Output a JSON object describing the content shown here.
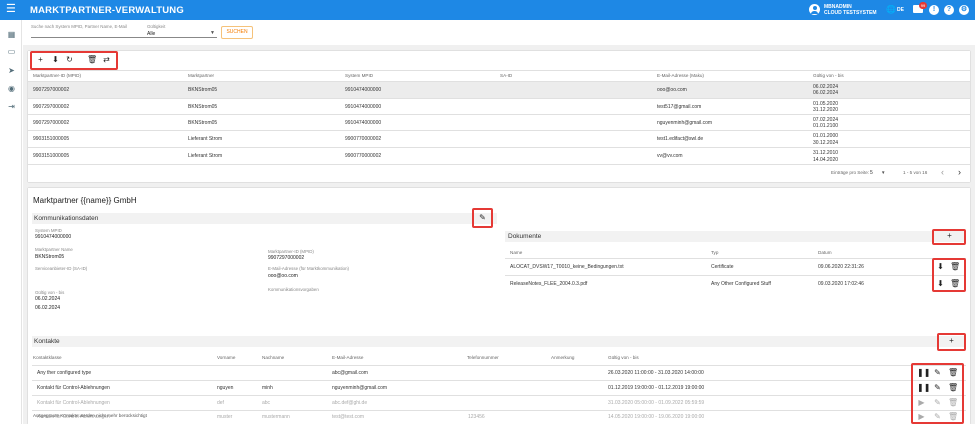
{
  "app": {
    "title": "MARKTPARTNER-VERWALTUNG",
    "user_name": "MBNADMIN",
    "user_system": "CLOUD TESTSYSTEM",
    "lang": "DE",
    "notif_count": "99"
  },
  "search": {
    "placeholder": "Suche nach System MPID, Partner Name, E-Mail",
    "gueltig_label": "Gültigkeit",
    "gueltig_value": "Alle",
    "button": "SUCHEN"
  },
  "table": {
    "headers": [
      "Marktpartner-ID (MPID)",
      "Marktpartner",
      "System MPID",
      "SA-ID",
      "E-Mail-Adresse (Maku)",
      "Gültig von - bis"
    ],
    "rows": [
      {
        "mpid": "9907297000002",
        "partner": "BKNStrom05",
        "system": "9910474000000",
        "said": "",
        "email": "ooo@oo.com",
        "valid": [
          "06.02.2024",
          "06.02.2024"
        ]
      },
      {
        "mpid": "9907297000002",
        "partner": "BKNStrom05",
        "system": "9910474000000",
        "said": "",
        "email": "test517@gmail.com",
        "valid": [
          "01.05.2020",
          "31.12.2020"
        ]
      },
      {
        "mpid": "9907297000002",
        "partner": "BKNStrom05",
        "system": "9910474000000",
        "said": "",
        "email": "nguyenminh@gmail.com",
        "valid": [
          "07.02.2024",
          "01.01.2100"
        ]
      },
      {
        "mpid": "9903151000005",
        "partner": "Lieferant Strom",
        "system": "9900770000002",
        "said": "",
        "email": "test1.edifact@swl.de",
        "valid": [
          "01.01.2000",
          "30.12.2024"
        ]
      },
      {
        "mpid": "9903151000005",
        "partner": "Lieferant Strom",
        "system": "9900770000002",
        "said": "",
        "email": "vv@vv.com",
        "valid": [
          "31.12.2010",
          "14.04.2020"
        ]
      }
    ],
    "per_page_label": "Einträge pro Seite:",
    "per_page": "5",
    "range": "1 - 5 von 16"
  },
  "detail": {
    "title": "Marktpartner {{name}} GmbH",
    "komm": {
      "title": "Kommunikationsdaten",
      "system_mpid_label": "System MPID",
      "system_mpid": "9910474000000",
      "name_label": "Marktpartner Name",
      "name": "BKNStrom05",
      "mpid_label": "Marktpartner-ID (MPID)",
      "mpid": "9907297000002",
      "said_label": "Serviceanbieter-ID (SA-ID)",
      "email_label": "E-Mail-Adresse (für Marktkommunikation)",
      "email": "ooo@oo.com",
      "vorgaben_label": "Kommunikationsvorgaben",
      "valid_label": "Gültig von - bis",
      "valid_from": "06.02.2024",
      "valid_to": "06.02.2024"
    },
    "docs": {
      "title": "Dokumente",
      "headers": [
        "Name",
        "Typ",
        "Datum"
      ],
      "rows": [
        {
          "name": "ALOCAT_DVSW17_T0010_keine_Bedingungen.txt",
          "typ": "Certificate",
          "datum": "09.06.2020 22:31:26"
        },
        {
          "name": "ReleaseNotes_FLEE_2004.0.3.pdf",
          "typ": "Any Other Configured Stuff",
          "datum": "09.03.2020 17:02:46"
        }
      ]
    },
    "kontakte": {
      "title": "Kontakte",
      "headers": [
        "Kontaktklasse",
        "Vorname",
        "Nachname",
        "E-Mail-Adresse",
        "Telefonnummer",
        "Anmerkung",
        "Gültig von - bis"
      ],
      "rows": [
        {
          "klasse": "Any ther configured type",
          "vorname": "",
          "nachname": "",
          "email": "abc@gmail.com",
          "tel": "",
          "anm": "",
          "valid": "26.03.2020 11:00:00 - 31.03.2020 14:00:00"
        },
        {
          "klasse": "Kontakt für Control-Ablehnungen",
          "vorname": "nguyen",
          "nachname": "minh",
          "email": "nguyenminh@gmail.com",
          "tel": "",
          "anm": "",
          "valid": "01.12.2019 19:00:00 - 01.12.2019 19:00:00"
        },
        {
          "klasse": "Kontakt für Control-Ablehnungen",
          "vorname": "def",
          "nachname": "abc",
          "email": "abc.def@ghi.de",
          "tel": "",
          "anm": "",
          "valid": "31.03.2020 05:00:00 - 01.09.2022 05:59:59"
        },
        {
          "klasse": "Kontakt für Control-Ablehnungen",
          "vorname": "muster",
          "nachname": "mustermann",
          "email": "test@test.com",
          "tel": "123456",
          "anm": "",
          "valid": "14.05.2020 19:00:00 - 19.06.2020 19:00:00"
        }
      ],
      "footer": "Ausgegraute Kontakte werden nicht mehr berücksichtigt"
    }
  }
}
